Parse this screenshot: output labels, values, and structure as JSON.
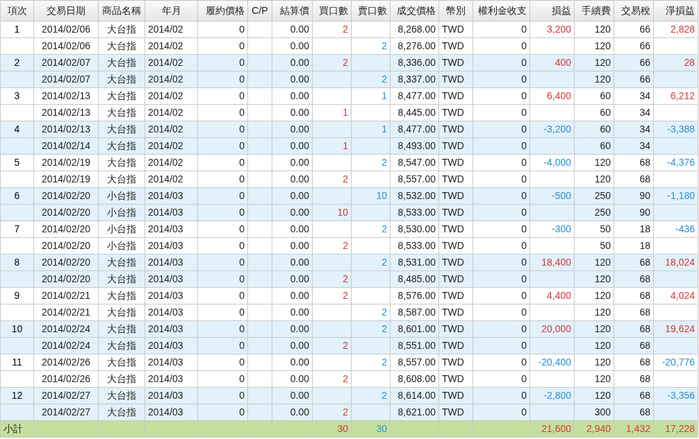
{
  "columns": [
    "項次",
    "交易日期",
    "商品名稱",
    "年月",
    "履約價格",
    "C/P",
    "結算價",
    "買口數",
    "賣口數",
    "成交價格",
    "幣別",
    "權利金收支",
    "損益",
    "手續費",
    "交易稅",
    "淨損益"
  ],
  "groups": [
    {
      "no": "1",
      "shaded": false,
      "loss": false,
      "legs": [
        {
          "date": "2014/02/06",
          "product": "大台指",
          "month": "2014/02",
          "strike": "0",
          "settle": "0.00",
          "buy": "2",
          "price": "8,268.00",
          "currency": "TWD",
          "premium": "0",
          "pnl": "3,200",
          "fee": "120",
          "tax": "66",
          "net": "2,828"
        },
        {
          "date": "2014/02/06",
          "product": "大台指",
          "month": "2014/02",
          "strike": "0",
          "settle": "0.00",
          "sell": "2",
          "price": "8,276.00",
          "currency": "TWD",
          "premium": "0",
          "fee": "120",
          "tax": "66"
        }
      ]
    },
    {
      "no": "2",
      "shaded": true,
      "loss": false,
      "legs": [
        {
          "date": "2014/02/07",
          "product": "大台指",
          "month": "2014/02",
          "strike": "0",
          "settle": "0.00",
          "buy": "2",
          "price": "8,336.00",
          "currency": "TWD",
          "premium": "0",
          "pnl": "400",
          "fee": "120",
          "tax": "66",
          "net": "28"
        },
        {
          "date": "2014/02/07",
          "product": "大台指",
          "month": "2014/02",
          "strike": "0",
          "settle": "0.00",
          "sell": "2",
          "price": "8,337.00",
          "currency": "TWD",
          "premium": "0",
          "fee": "120",
          "tax": "66"
        }
      ]
    },
    {
      "no": "3",
      "shaded": false,
      "loss": false,
      "legs": [
        {
          "date": "2014/02/13",
          "product": "大台指",
          "month": "2014/02",
          "strike": "0",
          "settle": "0.00",
          "sell": "1",
          "price": "8,477.00",
          "currency": "TWD",
          "premium": "0",
          "pnl": "6,400",
          "fee": "60",
          "tax": "34",
          "net": "6,212"
        },
        {
          "date": "2014/02/13",
          "product": "大台指",
          "month": "2014/02",
          "strike": "0",
          "settle": "0.00",
          "buy": "1",
          "price": "8,445.00",
          "currency": "TWD",
          "premium": "0",
          "fee": "60",
          "tax": "34"
        }
      ]
    },
    {
      "no": "4",
      "shaded": true,
      "loss": true,
      "legs": [
        {
          "date": "2014/02/13",
          "product": "大台指",
          "month": "2014/02",
          "strike": "0",
          "settle": "0.00",
          "sell": "1",
          "price": "8,477.00",
          "currency": "TWD",
          "premium": "0",
          "pnl": "-3,200",
          "fee": "60",
          "tax": "34",
          "net": "-3,388"
        },
        {
          "date": "2014/02/14",
          "product": "大台指",
          "month": "2014/02",
          "strike": "0",
          "settle": "0.00",
          "buy": "1",
          "price": "8,493.00",
          "currency": "TWD",
          "premium": "0",
          "fee": "60",
          "tax": "34"
        }
      ]
    },
    {
      "no": "5",
      "shaded": false,
      "loss": true,
      "legs": [
        {
          "date": "2014/02/19",
          "product": "大台指",
          "month": "2014/02",
          "strike": "0",
          "settle": "0.00",
          "sell": "2",
          "price": "8,547.00",
          "currency": "TWD",
          "premium": "0",
          "pnl": "-4,000",
          "fee": "120",
          "tax": "68",
          "net": "-4,376"
        },
        {
          "date": "2014/02/19",
          "product": "大台指",
          "month": "2014/02",
          "strike": "0",
          "settle": "0.00",
          "buy": "2",
          "price": "8,557.00",
          "currency": "TWD",
          "premium": "0",
          "fee": "120",
          "tax": "68"
        }
      ]
    },
    {
      "no": "6",
      "shaded": true,
      "loss": true,
      "legs": [
        {
          "date": "2014/02/20",
          "product": "小台指",
          "month": "2014/03",
          "strike": "0",
          "settle": "0.00",
          "sell": "10",
          "price": "8,532.00",
          "currency": "TWD",
          "premium": "0",
          "pnl": "-500",
          "fee": "250",
          "tax": "90",
          "net": "-1,180"
        },
        {
          "date": "2014/02/20",
          "product": "小台指",
          "month": "2014/03",
          "strike": "0",
          "settle": "0.00",
          "buy": "10",
          "price": "8,533.00",
          "currency": "TWD",
          "premium": "0",
          "fee": "250",
          "tax": "90"
        }
      ]
    },
    {
      "no": "7",
      "shaded": false,
      "loss": true,
      "legs": [
        {
          "date": "2014/02/20",
          "product": "小台指",
          "month": "2014/03",
          "strike": "0",
          "settle": "0.00",
          "sell": "2",
          "price": "8,530.00",
          "currency": "TWD",
          "premium": "0",
          "pnl": "-300",
          "fee": "50",
          "tax": "18",
          "net": "-436"
        },
        {
          "date": "2014/02/20",
          "product": "小台指",
          "month": "2014/03",
          "strike": "0",
          "settle": "0.00",
          "buy": "2",
          "price": "8,533.00",
          "currency": "TWD",
          "premium": "0",
          "fee": "50",
          "tax": "18"
        }
      ]
    },
    {
      "no": "8",
      "shaded": true,
      "loss": false,
      "legs": [
        {
          "date": "2014/02/20",
          "product": "大台指",
          "month": "2014/03",
          "strike": "0",
          "settle": "0.00",
          "sell": "2",
          "price": "8,531.00",
          "currency": "TWD",
          "premium": "0",
          "pnl": "18,400",
          "fee": "120",
          "tax": "68",
          "net": "18,024"
        },
        {
          "date": "2014/02/20",
          "product": "大台指",
          "month": "2014/03",
          "strike": "0",
          "settle": "0.00",
          "buy": "2",
          "price": "8,485.00",
          "currency": "TWD",
          "premium": "0",
          "fee": "120",
          "tax": "68"
        }
      ]
    },
    {
      "no": "9",
      "shaded": false,
      "loss": false,
      "legs": [
        {
          "date": "2014/02/21",
          "product": "大台指",
          "month": "2014/03",
          "strike": "0",
          "settle": "0.00",
          "buy": "2",
          "price": "8,576.00",
          "currency": "TWD",
          "premium": "0",
          "pnl": "4,400",
          "fee": "120",
          "tax": "68",
          "net": "4,024"
        },
        {
          "date": "2014/02/21",
          "product": "大台指",
          "month": "2014/03",
          "strike": "0",
          "settle": "0.00",
          "sell": "2",
          "price": "8,587.00",
          "currency": "TWD",
          "premium": "0",
          "fee": "120",
          "tax": "68"
        }
      ]
    },
    {
      "no": "10",
      "shaded": true,
      "loss": false,
      "legs": [
        {
          "date": "2014/02/24",
          "product": "大台指",
          "month": "2014/03",
          "strike": "0",
          "settle": "0.00",
          "sell": "2",
          "price": "8,601.00",
          "currency": "TWD",
          "premium": "0",
          "pnl": "20,000",
          "fee": "120",
          "tax": "68",
          "net": "19,624"
        },
        {
          "date": "2014/02/24",
          "product": "大台指",
          "month": "2014/03",
          "strike": "0",
          "settle": "0.00",
          "buy": "2",
          "price": "8,551.00",
          "currency": "TWD",
          "premium": "0",
          "fee": "120",
          "tax": "68"
        }
      ]
    },
    {
      "no": "11",
      "shaded": false,
      "loss": true,
      "legs": [
        {
          "date": "2014/02/26",
          "product": "大台指",
          "month": "2014/03",
          "strike": "0",
          "settle": "0.00",
          "sell": "2",
          "price": "8,557.00",
          "currency": "TWD",
          "premium": "0",
          "pnl": "-20,400",
          "fee": "120",
          "tax": "68",
          "net": "-20,776"
        },
        {
          "date": "2014/02/26",
          "product": "大台指",
          "month": "2014/03",
          "strike": "0",
          "settle": "0.00",
          "buy": "2",
          "price": "8,608.00",
          "currency": "TWD",
          "premium": "0",
          "fee": "120",
          "tax": "68"
        }
      ]
    },
    {
      "no": "12",
      "shaded": true,
      "loss": true,
      "legs": [
        {
          "date": "2014/02/27",
          "product": "大台指",
          "month": "2014/03",
          "strike": "0",
          "settle": "0.00",
          "sell": "2",
          "price": "8,614.00",
          "currency": "TWD",
          "premium": "0",
          "pnl": "-2,800",
          "fee": "120",
          "tax": "68",
          "net": "-3,356"
        },
        {
          "date": "2014/02/27",
          "product": "大台指",
          "month": "2014/03",
          "strike": "0",
          "settle": "0.00",
          "buy": "2",
          "price": "8,621.00",
          "currency": "TWD",
          "premium": "0",
          "fee": "300",
          "tax": "68"
        }
      ]
    }
  ],
  "subtotal": {
    "label": "小計",
    "buy": "30",
    "sell": "30",
    "pnl": "21,600",
    "fee": "2,940",
    "tax": "1,432",
    "net": "17,228"
  }
}
